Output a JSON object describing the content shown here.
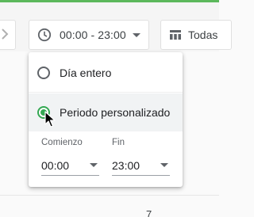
{
  "toolbar": {
    "time_range_label": "00:00 - 23:00",
    "scope_label": "Todas",
    "icons": {
      "left_chip": "chevron-right-icon",
      "time": "clock-icon",
      "scope": "calendar-view-icon"
    }
  },
  "dropdown": {
    "options": [
      {
        "label": "Día entero",
        "selected": false
      },
      {
        "label": "Periodo personalizado",
        "selected": true
      }
    ],
    "start": {
      "label": "Comienzo",
      "value": "00:00"
    },
    "end": {
      "label": "Fin",
      "value": "23:00"
    }
  },
  "background": {
    "partial_text": "7"
  },
  "colors": {
    "accent_green": "#34a853",
    "top_strip": "#5cb85c"
  }
}
